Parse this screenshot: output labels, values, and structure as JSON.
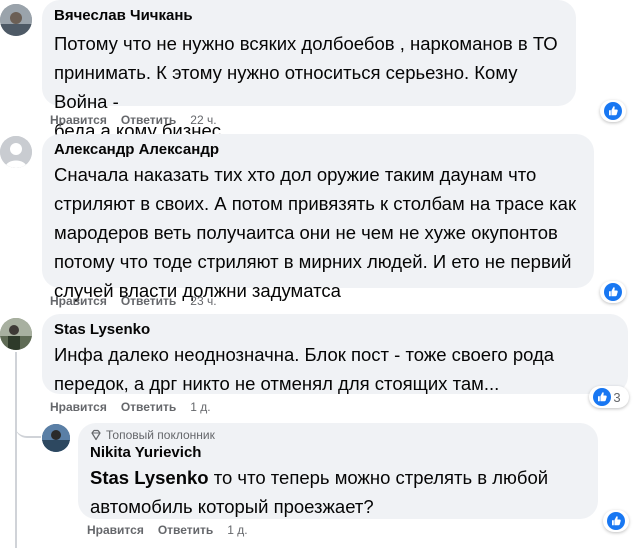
{
  "colors": {
    "bubble": "#f0f2f5",
    "meta": "#65676b",
    "like_blue": "#1877f2"
  },
  "comments": [
    {
      "author": "Вячеслав Чичкань",
      "lines": [
        "Потому что не нужно всяких долбоебов , наркоманов в ТО",
        "принимать. К этому нужно относиться серьезно. Кому Война -",
        "беда а кому бизнес."
      ],
      "like": "Нравится",
      "reply": "Ответить",
      "time": "22 ч.",
      "reaction_icon": "like-icon"
    },
    {
      "author": "Александр Александр",
      "lines": [
        "Сначала наказать тих хто дол оружие таким даунам что",
        "стриляют в своих. А потом привязять к столбам на трасе как",
        "мародеров веть получаитса они не чем не хуже окупонтов",
        "потому что тоде стриляют в мирних людей. И ето не первий",
        "случей власти должни задуматса"
      ],
      "like": "Нравится",
      "reply": "Ответить",
      "time": "23 ч.",
      "reaction_icon": "like-icon"
    },
    {
      "author": "Stas Lysenko",
      "lines": [
        "Инфа далеко неоднозначна. Блок пост - тоже своего рода",
        "передок, а дрг никто не отменял для стоящих там..."
      ],
      "like": "Нравится",
      "reply": "Ответить",
      "time": "1 д.",
      "reaction_icon": "like-icon",
      "reaction_count": "3"
    }
  ],
  "reply": {
    "badge": "Топовый поклонник",
    "badge_icon": "diamond-icon",
    "author": "Nikita Yurievich",
    "mention": "Stas Lysenko",
    "line1_rest": " то что теперь можно стрелять в любой",
    "line2": "автомобиль который проезжает?",
    "like": "Нравится",
    "reply": "Ответить",
    "time": "1 д.",
    "reaction_icon": "like-icon"
  }
}
